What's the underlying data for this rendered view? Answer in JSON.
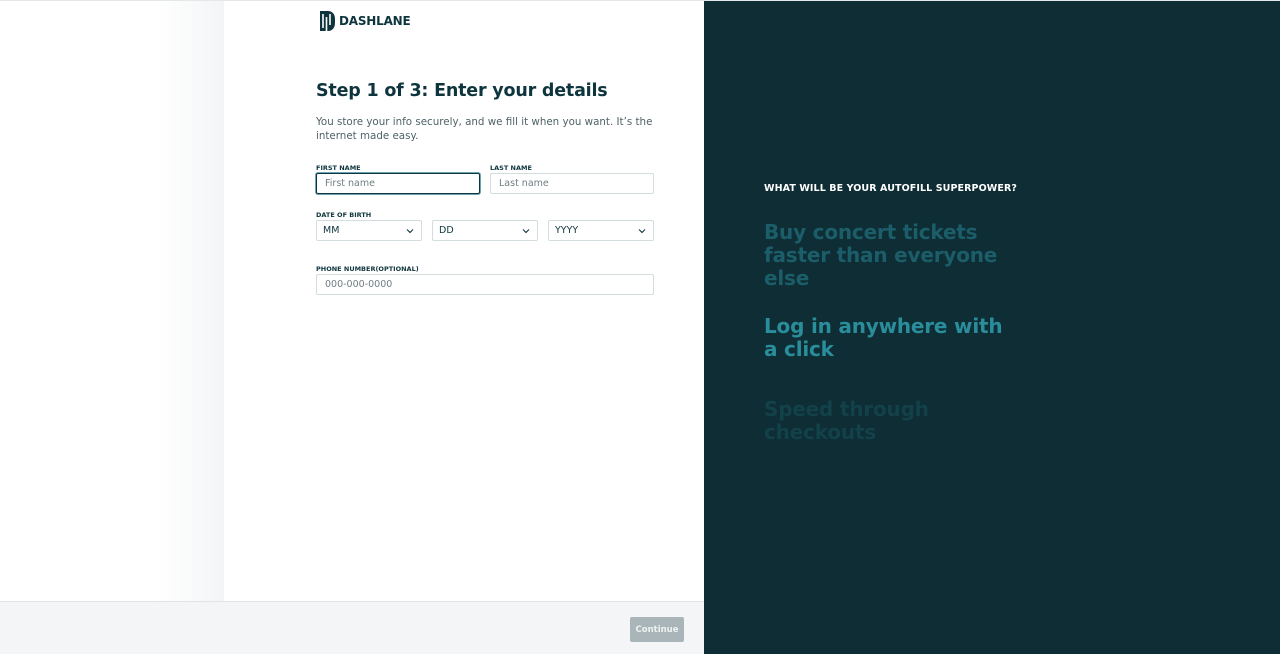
{
  "brand": {
    "name": "DASHLANE"
  },
  "form": {
    "title": "Step 1 of 3: Enter your details",
    "intro": "You store your info securely, and we fill it when you want. It’s the internet made easy.",
    "first_name": {
      "label": "FIRST NAME",
      "placeholder": "First name",
      "value": ""
    },
    "last_name": {
      "label": "LAST NAME",
      "placeholder": "Last name",
      "value": ""
    },
    "dob": {
      "label": "DATE OF BIRTH",
      "month": "MM",
      "day": "DD",
      "year": "YYYY"
    },
    "phone": {
      "label": "PHONE NUMBER(OPTIONAL)",
      "placeholder": "000-000-0000",
      "value": ""
    }
  },
  "footer": {
    "continue_label": "Continue"
  },
  "promo": {
    "question": "WHAT WILL BE YOUR AUTOFILL SUPERPOWER?",
    "items": [
      "Buy concert tickets faster than everyone else",
      "Log in anywhere with a click",
      "Speed through checkouts"
    ]
  },
  "colors": {
    "brand_dark": "#0e353d",
    "panel_bg": "#0e2d34",
    "accent_teal": "#2a8d9c",
    "button_disabled": "#a9b5b8"
  }
}
